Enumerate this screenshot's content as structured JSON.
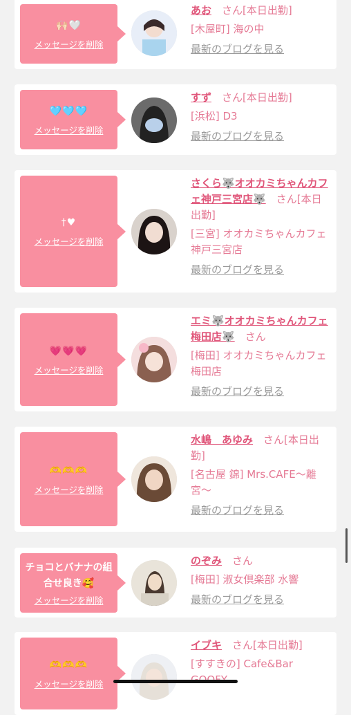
{
  "delete_label": "メッセージを削除",
  "blog_label": "最新のブログを見る",
  "san": "さん",
  "cards": [
    {
      "message": "🙌🏻🤍",
      "name": "あお",
      "status": "[本日出勤]",
      "location": "[木屋町] 海の中"
    },
    {
      "message": "🩵🩵🩵",
      "name": "すず",
      "status": "[本日出勤]",
      "location": "[浜松] D3"
    },
    {
      "message": "†♥",
      "name": "さくら🐺オオカミちゃんカフェ神戸三宮店🐺",
      "status": "[本日出勤]",
      "location": "[三宮] オオカミちゃんカフェ神戸三宮店"
    },
    {
      "message": "💗💗💗",
      "name": "エミ🐺オオカミちゃんカフェ梅田店🐺",
      "status": "",
      "location": "[梅田] オオカミちゃんカフェ梅田店"
    },
    {
      "message": "🫶🫶🫶",
      "name": "水嶋　あゆみ",
      "status": "[本日出勤]",
      "location": "[名古屋 錦] Mrs.CAFE〜離宮〜"
    },
    {
      "message": "チョコとバナナの組合せ良き🥰",
      "name": "のぞみ",
      "status": "",
      "location": "[梅田] 淑女倶楽部 水響"
    },
    {
      "message": "🫶🫶🫶",
      "name": "イブキ",
      "status": "[本日出勤]",
      "location": "[すすきの] Cafe&Bar GOOFY"
    }
  ],
  "colors": {
    "accent": "#e0567a",
    "message_bg": "#f98fa0",
    "page_bg": "#f2f2f2"
  }
}
